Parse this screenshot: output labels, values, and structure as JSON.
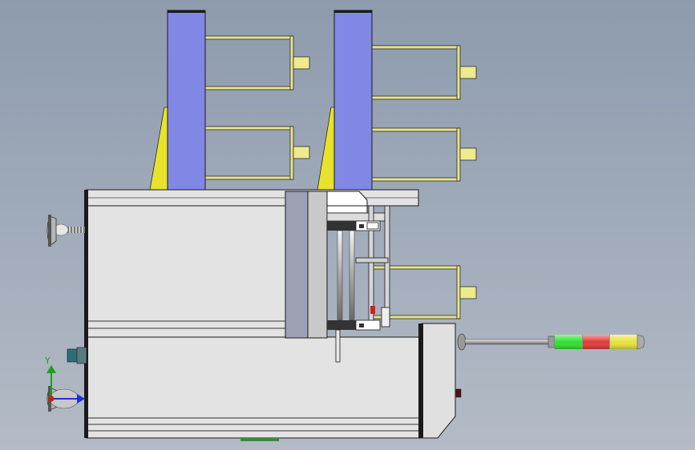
{
  "colors": {
    "bg_top": "#8d9bad",
    "bg_bottom": "#b4bbc6",
    "frame_fill": "#e3e3e3",
    "frame_stroke": "#1a1a1a",
    "blue_post": "#8187e5",
    "tray_yellow": "#e6e38c",
    "tab_yellow": "#eeea8e",
    "gusset_yellow": "#e8e22c",
    "plate_gray": "#9ea0b3",
    "light_green": "#2ee12e",
    "light_red": "#e03a3a",
    "light_yellow": "#e8e23a",
    "axis_y": "#1aa01a",
    "axis_x": "#2030d0",
    "axis_z": "#d01a1a"
  },
  "axis_triad": {
    "y_label": "Y"
  },
  "parts": {
    "base_frame": "base-frame-icon",
    "vertical_post": "vertical-post-icon",
    "tray": "tray-icon",
    "linear_rail": "linear-rail-icon",
    "leveling_foot": "leveling-foot-icon",
    "signal_tower": "signal-tower-icon",
    "control_box": "control-box-icon"
  }
}
